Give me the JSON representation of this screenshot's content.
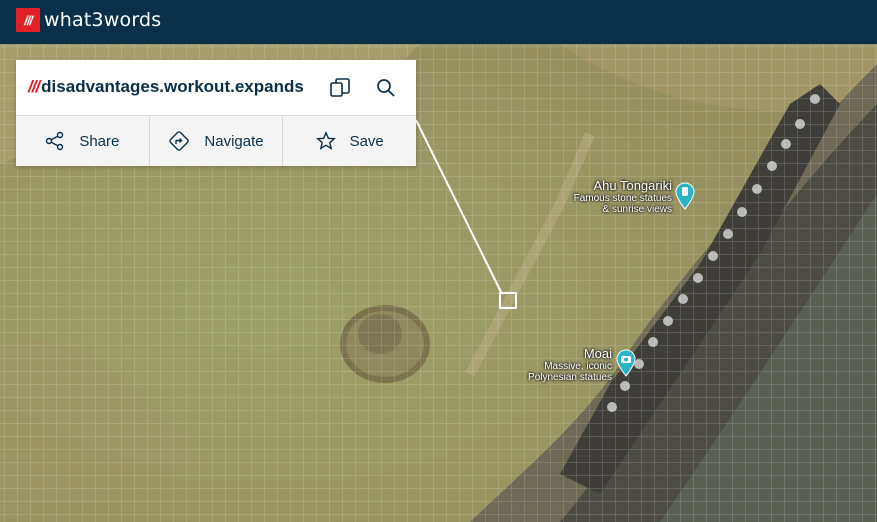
{
  "header": {
    "logo_mark": "///",
    "brand": "what3words"
  },
  "address": {
    "prefix": "///",
    "words": "disadvantages.workout.expands"
  },
  "actions": {
    "share": "Share",
    "navigate": "Navigate",
    "save": "Save"
  },
  "map": {
    "places": [
      {
        "name": "Ahu Tongariki",
        "line1": "Famous stone statues",
        "line2": "& sunrise views",
        "pin_icon": "statue-icon"
      },
      {
        "name": "Moai",
        "line1": "Massive, iconic",
        "line2": "Polynesian statues",
        "pin_icon": "camera-icon"
      }
    ]
  },
  "colors": {
    "header_bg": "#0a3049",
    "brand_red": "#e11f26",
    "pin_teal": "#2bb3c6"
  }
}
